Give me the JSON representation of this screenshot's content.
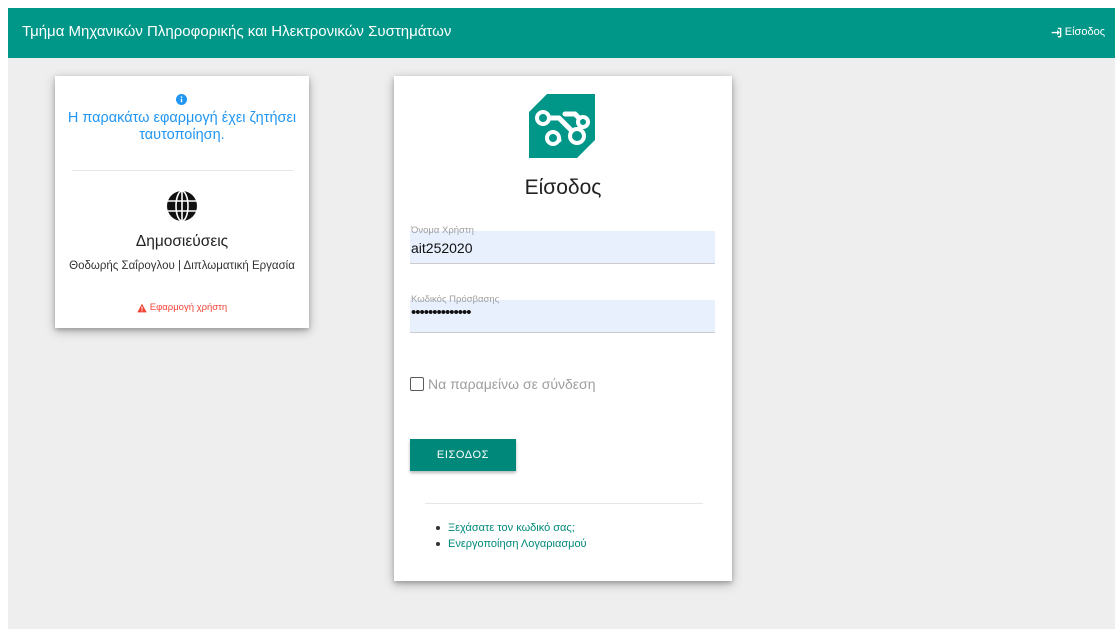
{
  "navbar": {
    "title": "Τμήμα Μηχανικών Πληροφορικής και Ηλεκτρονικών Συστημάτων",
    "login_link": "Είσοδος",
    "login_icon": "sign-in-icon",
    "color": "#009688"
  },
  "app_info": {
    "info_icon": "info-circle-icon",
    "message": "Η παρακάτω εφαρμογή έχει ζητήσει ταυτοποίηση.",
    "app_icon": "globe-icon",
    "app_name": "Δημοσιεύσεις",
    "app_description": "Θοδωρής Σαΐρογλου | Διπλωματική Εργασία",
    "app_type": "Εφαρμογή χρήστη",
    "app_type_icon": "warning-icon",
    "message_color": "#2196f3",
    "warning_color": "#f44336"
  },
  "login": {
    "logo": "department-logo",
    "heading": "Είσοδος",
    "username_label": "Όνομα Χρήστη",
    "username_value": "ait252020",
    "password_label": "Κωδικός Πρόσβασης",
    "password_value": "••••••••••••••",
    "remember_label": "Να παραμείνω σε σύνδεση",
    "remember_checked": false,
    "submit_label": "ΕΙΣΟΔΟΣ",
    "button_color": "#00897b",
    "links": [
      "Ξεχάσατε τον κωδικό σας;",
      "Ενεργοποίηση Λογαριασμού"
    ]
  }
}
